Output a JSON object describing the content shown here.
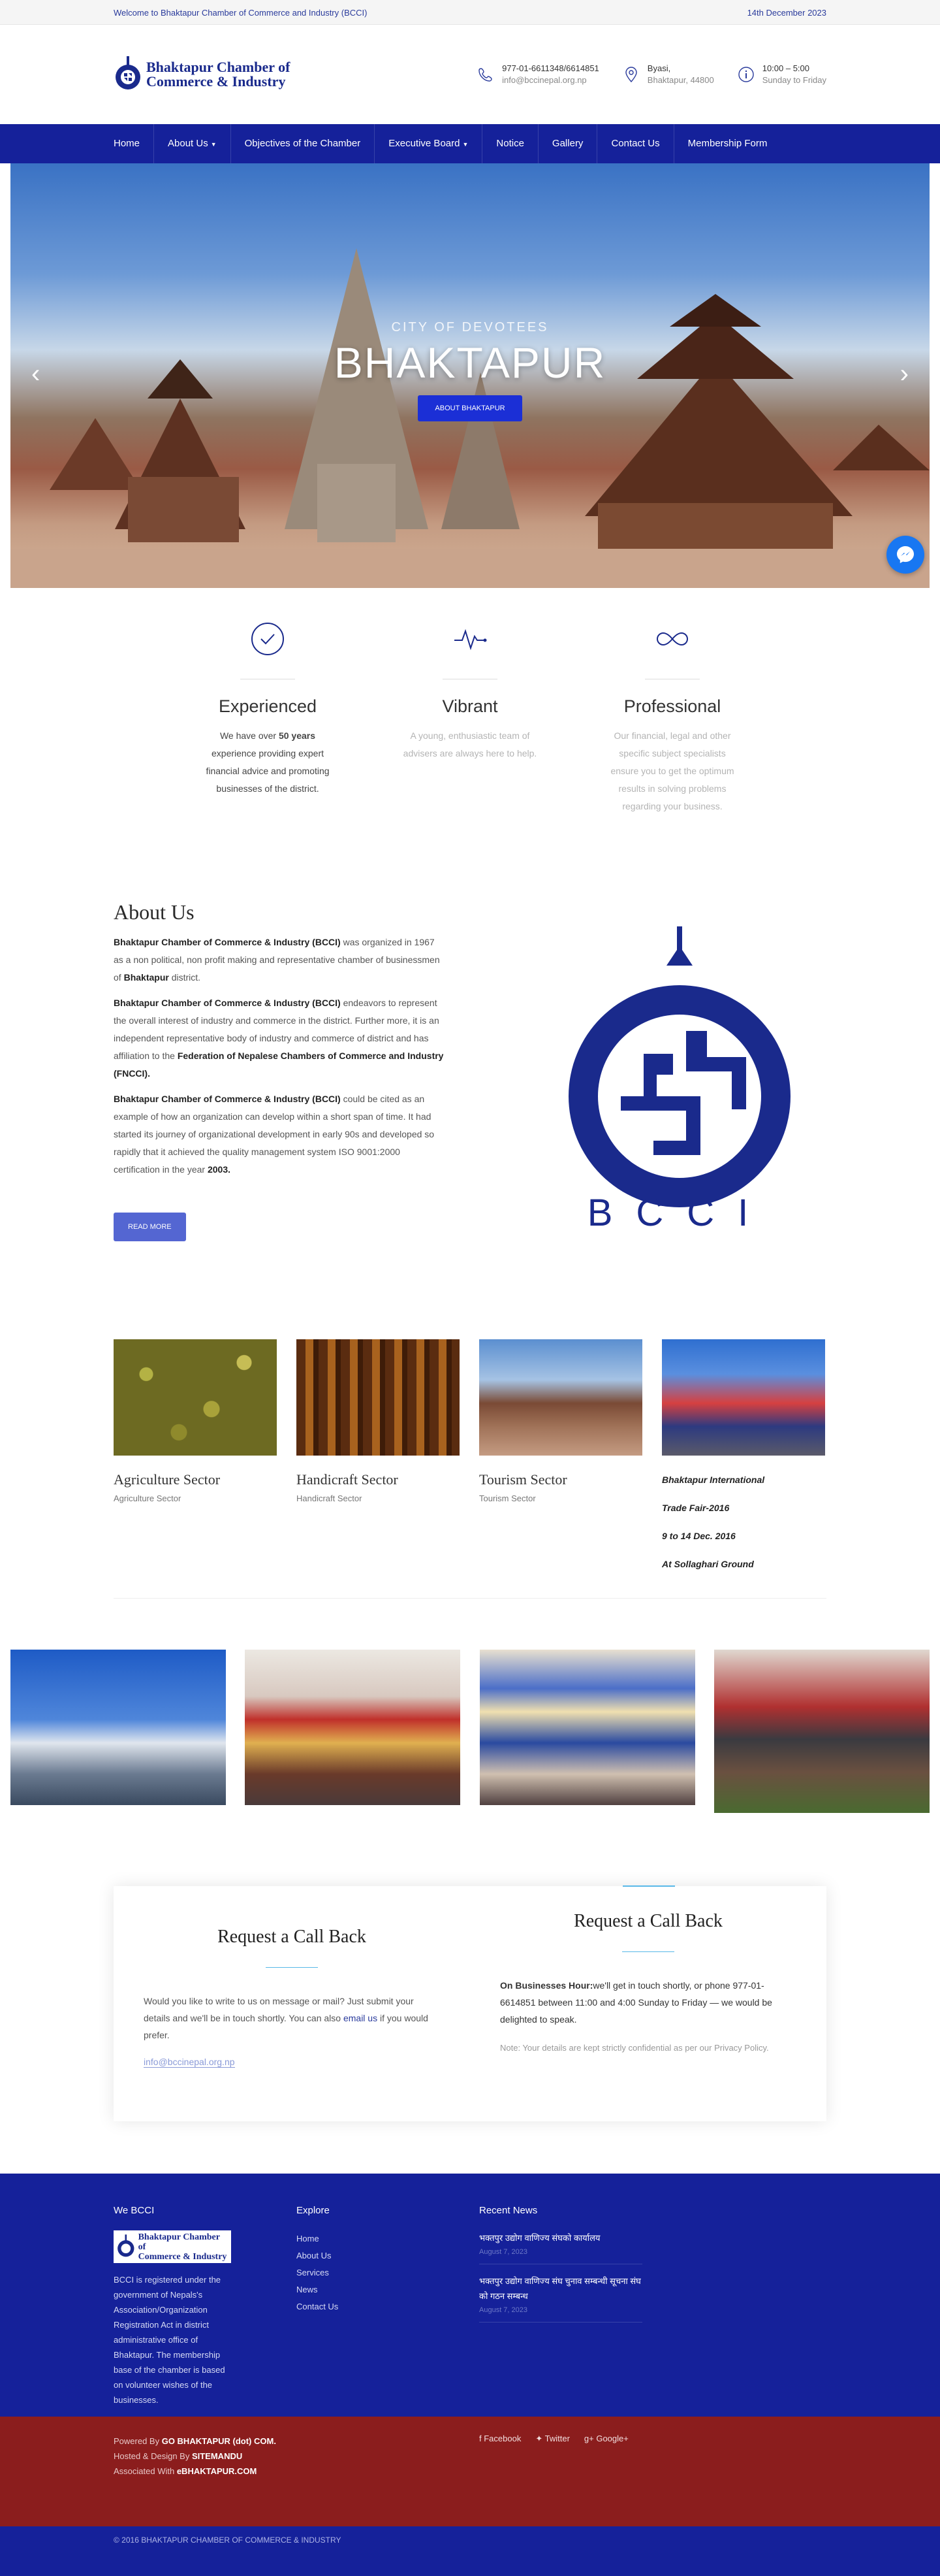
{
  "topbar": {
    "welcome": "Welcome to Bhaktapur Chamber of Commerce and Industry (BCCI)",
    "date": "14th December 2023"
  },
  "header": {
    "logo_line1": "Bhaktapur Chamber of",
    "logo_line2": "Commerce & Industry",
    "phone": "977-01-6611348/6614851",
    "email": "info@bccinepal.org.np",
    "address1": "Byasi,",
    "address2": "Bhaktapur, 44800",
    "hours1": "10:00 – 5:00",
    "hours2": "Sunday to Friday"
  },
  "nav": [
    "Home",
    "About Us",
    "Objectives of the Chamber",
    "Executive Board",
    "Notice",
    "Gallery",
    "Contact Us",
    "Membership Form"
  ],
  "hero": {
    "sub": "CITY OF DEVOTEES",
    "title": "BHAKTAPUR",
    "button": "ABOUT BHAKTAPUR"
  },
  "features": [
    {
      "title": "Experienced",
      "text_pre": "We have over ",
      "text_bold": "50 years",
      "text_post": " experience providing expert financial advice and promoting businesses of the district."
    },
    {
      "title": "Vibrant",
      "text": "A young, enthusiastic team of advisers are always here to help."
    },
    {
      "title": "Professional",
      "text": "Our financial, legal and other specific subject specialists ensure you to get the optimum results in solving problems regarding your business."
    }
  ],
  "about": {
    "title": "About Us",
    "p1_b": "Bhaktapur Chamber of Commerce & Industry (BCCI)",
    "p1": " was organized in 1967 as a non political, non profit making and representative chamber of businessmen of ",
    "p1_b2": "Bhaktapur",
    "p1_end": " district.",
    "p2_b": "Bhaktapur Chamber of Commerce & Industry (BCCI)",
    "p2": " endeavors to represent the overall interest of industry and commerce in the district. Further more, it is an independent representative body of industry and commerce of district and has affiliation to the ",
    "p2_b2": "Federation of Nepalese Chambers of Commerce and Industry (FNCCI).",
    "p3_b": "Bhaktapur Chamber of Commerce & Industry (BCCI)",
    "p3": " could be cited as an example of how an organization can develop within a short span of time. It had started its journey of organizational development in early 90s and developed so rapidly that it achieved the quality management system ISO 9001:2000 certification in the year ",
    "p3_b2": "2003.",
    "button": "READ MORE",
    "emblem_text": "BCCI"
  },
  "sectors": [
    {
      "title": "Agriculture Sector",
      "caption": "Agriculture Sector"
    },
    {
      "title": "Handicraft Sector",
      "caption": "Handicraft Sector"
    },
    {
      "title": "Tourism Sector",
      "caption": "Tourism Sector"
    }
  ],
  "fair": [
    "Bhaktapur International",
    "Trade Fair-2016",
    "9 to 14 Dec. 2016",
    "At Sollaghari Ground"
  ],
  "request": {
    "title_left": "Request a Call Back",
    "title_right": "Request a Call Back",
    "left_pre": "Would you like to write to us on message or mail? Just submit your details and we'll be in touch shortly. You can also ",
    "left_link": "email us",
    "left_post": " if you would prefer.",
    "mail": "info@bccinepal.org.np",
    "right_b": "On Businesses Hour:",
    "right_text": "we'll get in touch shortly, or phone 977-01-6614851 between 11:00 and 4:00 Sunday to Friday — we would be delighted to speak.",
    "note": "Note: Your details are kept strictly confidential as per our Privacy Policy."
  },
  "footer": {
    "col1_title": "We BCCI",
    "col1_text": "BCCI is registered under the government of Nepals's Association/Organization Registration Act in district administrative office of Bhaktapur. The membership base of the chamber is based on volunteer wishes of the businesses.",
    "col2_title": "Explore",
    "explore": [
      "Home",
      "About Us",
      "Services",
      "News",
      "Contact Us"
    ],
    "col3_title": "Recent News",
    "news": [
      {
        "head": "भक्तपुर उद्योग वाणिज्य संघको कार्यालय",
        "date": "August 7, 2023"
      },
      {
        "head": "भक्तपुर उद्योग वाणिज्य संघ चुनाव सम्बन्धी सूचना संघ को गठन सम्बन्ध",
        "date": "August 7, 2023"
      }
    ],
    "powered_pre": "Powered By ",
    "powered_b": "GO BHAKTAPUR (dot) COM.",
    "hosted_pre": "Hosted & Design By ",
    "hosted_b": "SITEMANDU",
    "assoc_pre": "Associated With ",
    "assoc_b": "eBHAKTAPUR.COM",
    "social": [
      "Facebook",
      "Twitter",
      "Google+"
    ],
    "copyright": "© 2016 BHAKTAPUR CHAMBER OF COMMERCE & INDUSTRY"
  },
  "colors": {
    "nav": "#15219a",
    "footer_red": "#8b1d1d",
    "accent": "#58b8e8"
  }
}
